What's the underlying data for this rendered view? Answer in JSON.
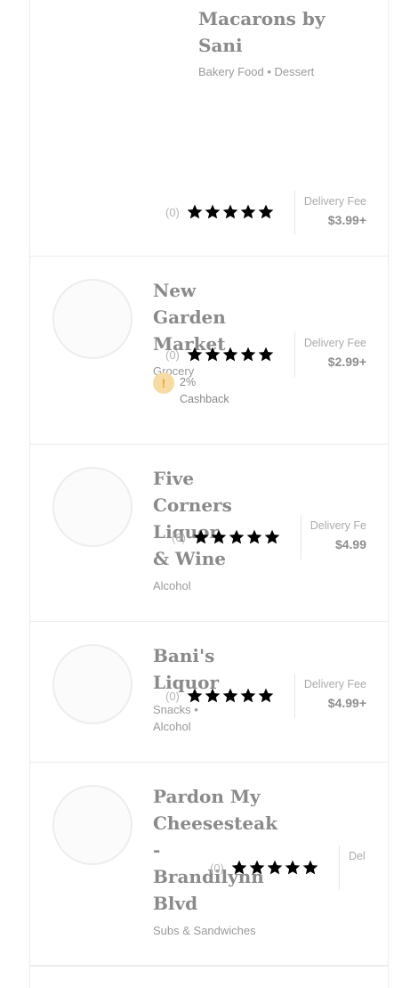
{
  "stores": [
    {
      "name_lines": [
        "Macarons by",
        "Sani"
      ],
      "category": "Bakery Food • Dessert",
      "rating_count": "(0)",
      "fee_label": "Delivery Fee",
      "fee_value": "$3.99+"
    },
    {
      "name_lines": [
        "New",
        "Garden",
        "Market"
      ],
      "category": "Grocery",
      "rating_count": "(0)",
      "fee_label": "Delivery Fee",
      "fee_value": "$2.99+",
      "cashback": {
        "icon": "!",
        "text": "2% Cashback"
      }
    },
    {
      "name_lines": [
        "Five",
        "Corners",
        "Liquor",
        "& Wine"
      ],
      "category": "Alcohol",
      "rating_count": "(0)",
      "fee_label": "Delivery Fe",
      "fee_value": "$4.99"
    },
    {
      "name_lines": [
        "Bani's",
        "Liquor"
      ],
      "category_lines": [
        "Snacks •",
        "Alcohol"
      ],
      "rating_count": "(0)",
      "fee_label": "Delivery Fee",
      "fee_value": "$4.99+"
    },
    {
      "name_lines": [
        "Pardon My",
        "Cheesesteak",
        "-",
        "Brandilynn",
        "Blvd"
      ],
      "category": "Subs & Sandwiches",
      "rating_count": "(0)",
      "fee_label": "Del"
    }
  ],
  "icons": {
    "star": "star-icon",
    "cashback": "cashback-coin-icon",
    "logo": "store-logo"
  },
  "colors": {
    "star_empty": "#ececec",
    "cashback_badge": "#f6dca2"
  }
}
